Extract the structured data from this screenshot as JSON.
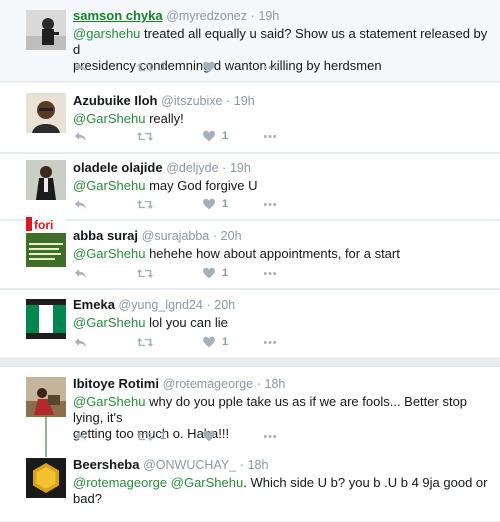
{
  "tweets": [
    {
      "name": "samson chyka",
      "handle": "@myredzonez",
      "dot": "·",
      "time": "19h",
      "line1_mention": "@garshehu",
      "line1_text": " treated all equally u said?  Show us a statement  released by d",
      "line2_text": "presidency  condemning d wanton killing by herdsmen",
      "retweets": "1",
      "likes": ""
    },
    {
      "name": "Azubuike Iloh",
      "handle": "@itszubixe",
      "dot": "·",
      "time": "19h",
      "mention": "@GarShehu",
      "text": " really!",
      "retweets": "",
      "likes": "1"
    },
    {
      "name": "oladele olajide",
      "handle": "@deljyde",
      "dot": "·",
      "time": "19h",
      "mention": "@GarShehu",
      "text": " may God forgive U",
      "retweets": "",
      "likes": "1"
    },
    {
      "name": "abba suraj",
      "handle": "@surajabba",
      "dot": "·",
      "time": "20h",
      "mention": "@GarShehu",
      "text": " hehehe how about appointments, for a start",
      "retweets": "",
      "likes": "1",
      "avatar_text": "fori"
    },
    {
      "name": "Emeka",
      "handle": "@yung_lgnd24",
      "dot": "·",
      "time": "20h",
      "mention": "@GarShehu",
      "text": " lol you can lie",
      "retweets": "",
      "likes": "1"
    },
    {
      "name": "Ibitoye Rotimi",
      "handle": "@rotemageorge",
      "dot": "·",
      "time": "18h",
      "mention": "@GarShehu",
      "line1_text": " why do you pple take us as if we are fools... Better stop lying, it's",
      "line2_text": "getting too much o. Haba!!!",
      "retweets": "1",
      "likes": ""
    },
    {
      "name": "Beersheba",
      "handle": "@ONWUCHAY_",
      "dot": "·",
      "time": "18h",
      "mention1": "@rotemageorge",
      "mention2": "@GarShehu",
      "text": ". Which side U b? you b .U b 4  9ja good or bad?"
    }
  ],
  "icons": {
    "reply": "reply-icon",
    "retweet": "retweet-icon",
    "like": "heart-icon",
    "more": "more-icon"
  },
  "colors": {
    "mention": "#2c8a3e",
    "icon": "#a4b1bb",
    "meta": "#8899a6",
    "background": "#e6ecf0"
  }
}
